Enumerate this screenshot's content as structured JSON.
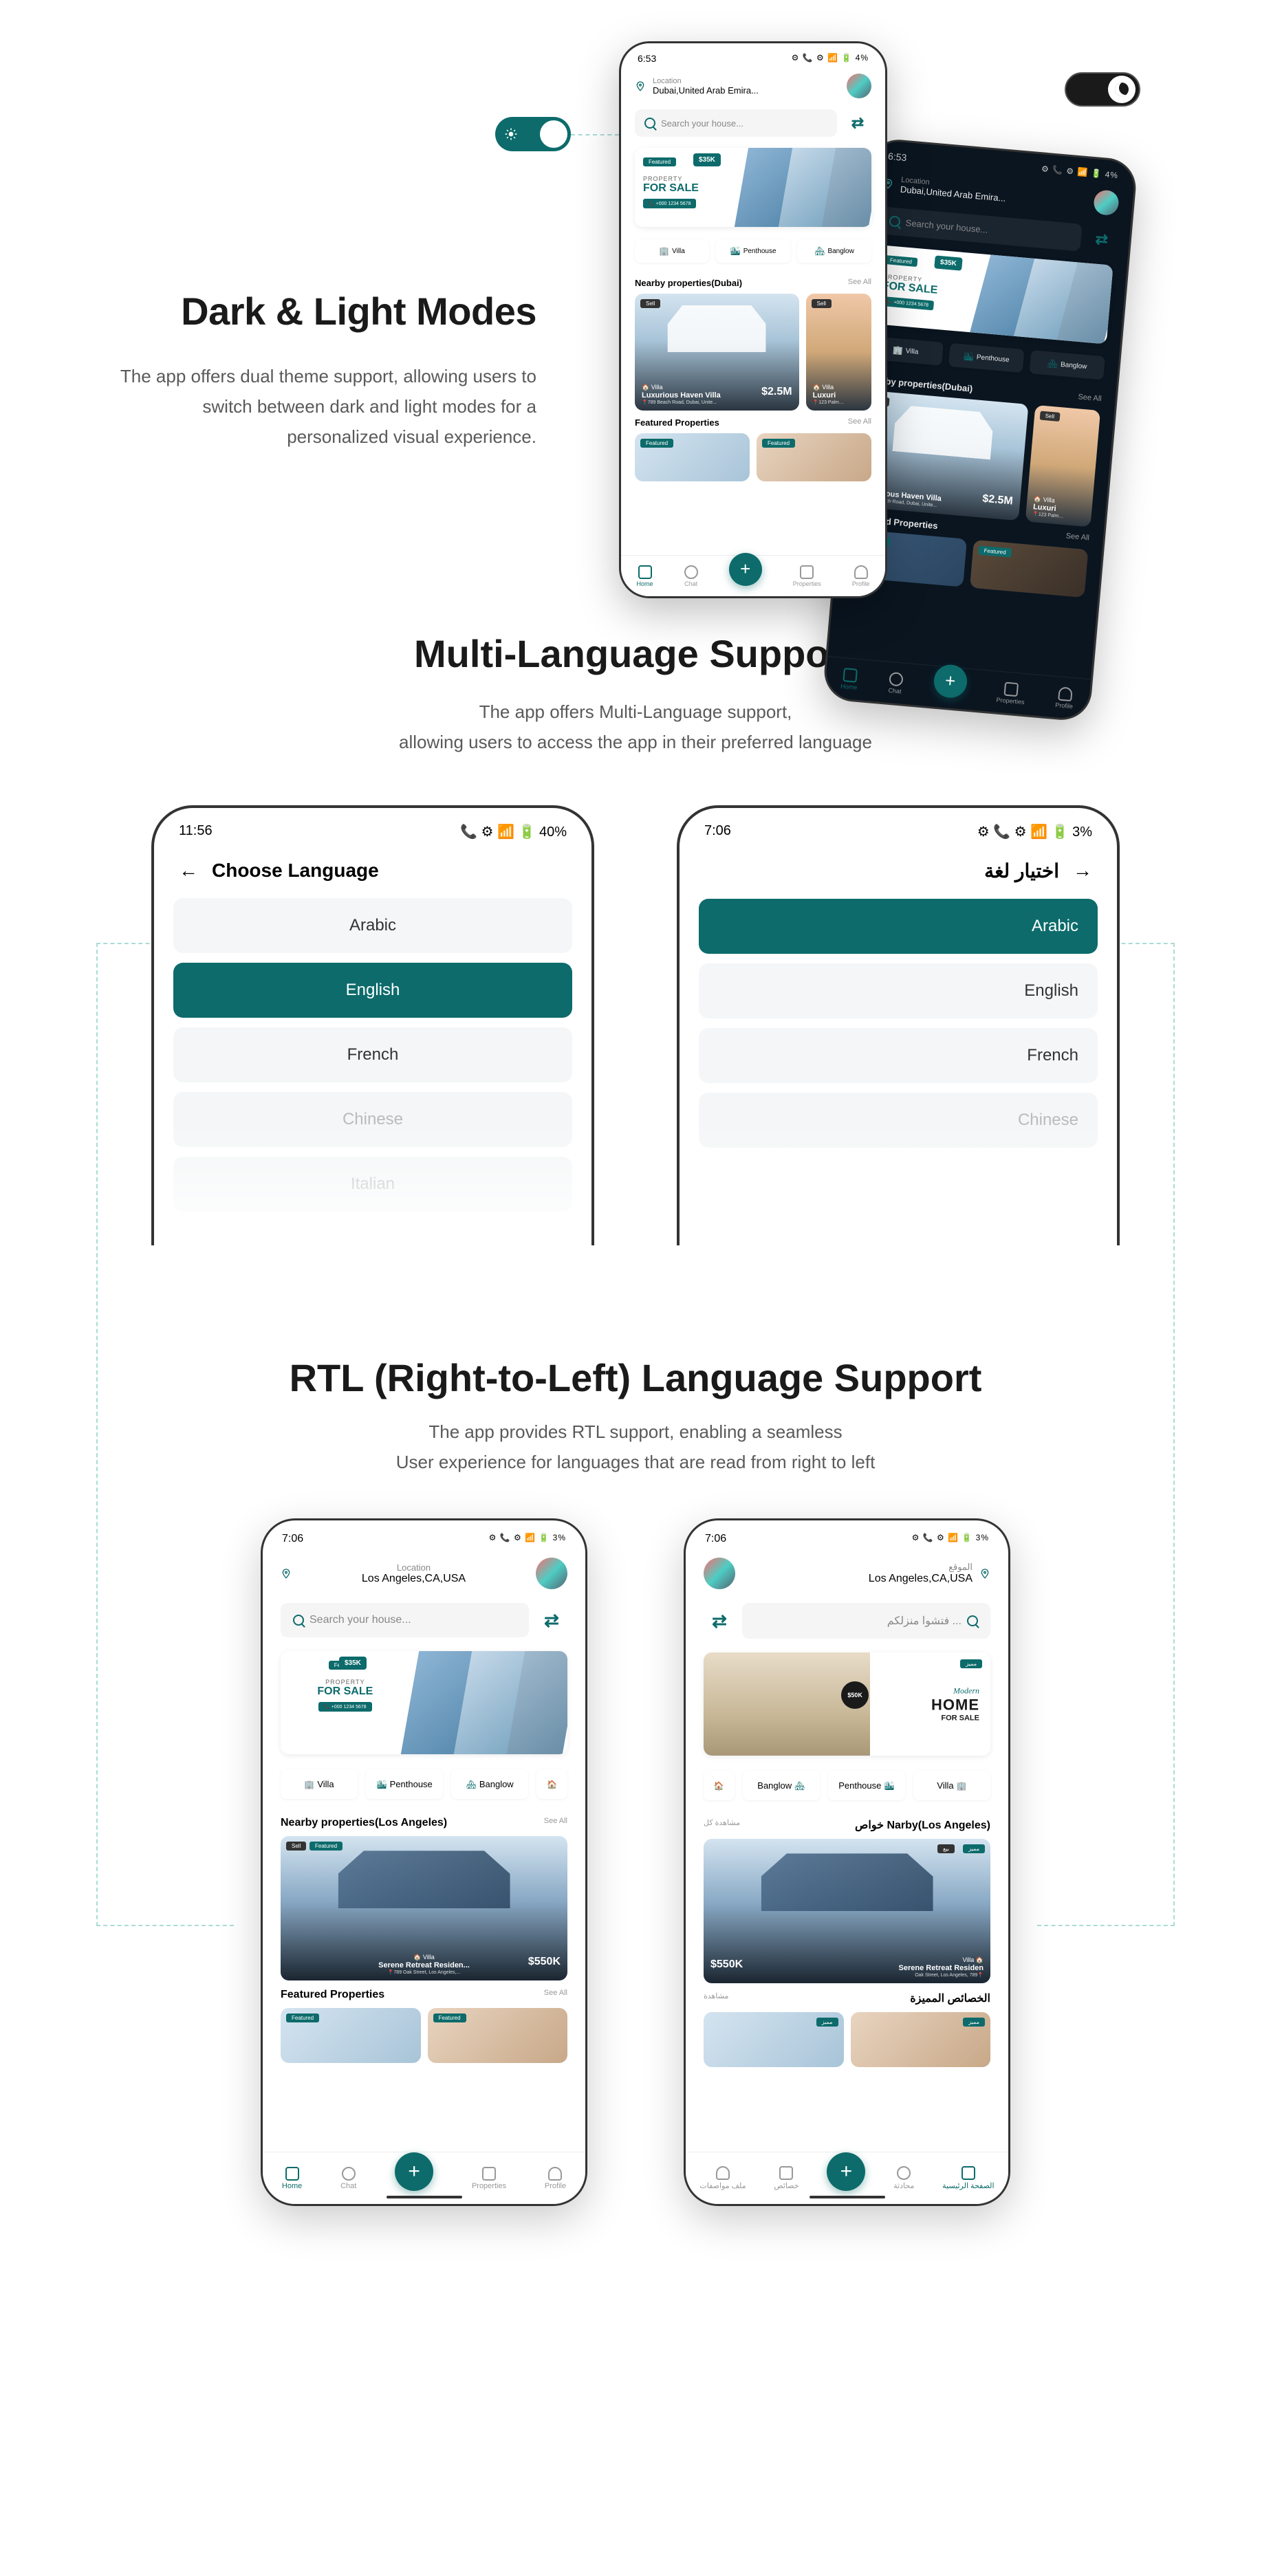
{
  "section1": {
    "title": "Dark & Light Modes",
    "desc": "The app offers dual theme support, allowing users to switch between dark and light modes for a personalized visual experience."
  },
  "section2": {
    "title": "Multi-Language Support",
    "desc1": "The app offers Multi-Language support,",
    "desc2": "allowing  users to access the app in their preferred language"
  },
  "section3": {
    "title": "RTL (Right-to-Left) Language Support",
    "desc1": "The app provides RTL support, enabling a seamless",
    "desc2": "User experience for languages that are read from right to left"
  },
  "phone": {
    "time_light": "6:53",
    "time_dark": "6:53",
    "status_icons": "⚙ 📞 ⚙ 📶 🔋 4%",
    "loc_label": "Location",
    "loc_value": "Dubai,United Arab Emira...",
    "search_placeholder": "Search your house...",
    "featured_tag": "Featured",
    "price_35k": "$35K",
    "banner_property": "PROPERTY",
    "banner_sale": "FOR SALE",
    "banner_phone": "📞 +000 1234 5678",
    "cat_villa": "Villa",
    "cat_penthouse": "Penthouse",
    "cat_banglow": "Banglow",
    "nearby_dubai": "Nearby properties(Dubai)",
    "see_all": "See All",
    "badge_sell": "Sell",
    "prop_type_villa": "🏠 Villa",
    "prop_name": "Luxurious Haven Villa",
    "prop_addr": "📍789 Beach Road, Dubai, Unite...",
    "prop_price": "$2.5M",
    "prop2_addr": "📍123 Palm…",
    "featured_section": "Featured Properties",
    "nav_home": "Home",
    "nav_chat": "Chat",
    "nav_properties": "Properties",
    "nav_profile": "Profile"
  },
  "lang": {
    "time_ltr": "11:56",
    "time_rtl": "7:06",
    "status_ltr": "📞 ⚙ 📶 🔋 40%",
    "status_rtl": "⚙ 📞 ⚙ 📶 🔋 3%",
    "title_ltr": "Choose Language",
    "title_rtl": "اختيار لغة",
    "arabic": "Arabic",
    "english": "English",
    "french": "French",
    "chinese": "Chinese",
    "italian": "Italian"
  },
  "rtl_phone": {
    "time": "7:06",
    "status": "⚙ 📞 ⚙ 📶 🔋 3%",
    "loc_label_en": "Location",
    "loc_label_ar": "الموقع",
    "loc_value": "Los Angeles,CA,USA",
    "search_en": "Search your house...",
    "search_ar": "فتشوا منزلكم ...",
    "nearby_la_en": "Nearby properties(Los Angeles)",
    "nearby_la_ar_l": "مشاهدة كل",
    "nearby_la_ar_r": "خواص Narby(Los Angeles)",
    "prop_name2": "Serene Retreat Residen...",
    "prop_name2_ar": "Serene Retreat Residen",
    "prop_addr2": "📍789 Oak Street, Los Angeles,...",
    "prop_addr2_ar": "Oak Street, Los Angeles, 789📍",
    "prop_price2": "$550K",
    "featured_ar": "الخصائص المميزة",
    "see_all_ar": "مشاهدة",
    "badge_featured_ar": "مميز",
    "badge_sell_ar": "بيع",
    "modern_label": "Modern",
    "modern_home": "HOME",
    "modern_sale": "FOR SALE",
    "modern_price": "$50K",
    "nav_home_ar": "الصفحة الرئيسية",
    "nav_chat_ar": "محادثة",
    "nav_properties_ar": "خصائص",
    "nav_profile_ar": "ملف مواصفات"
  }
}
